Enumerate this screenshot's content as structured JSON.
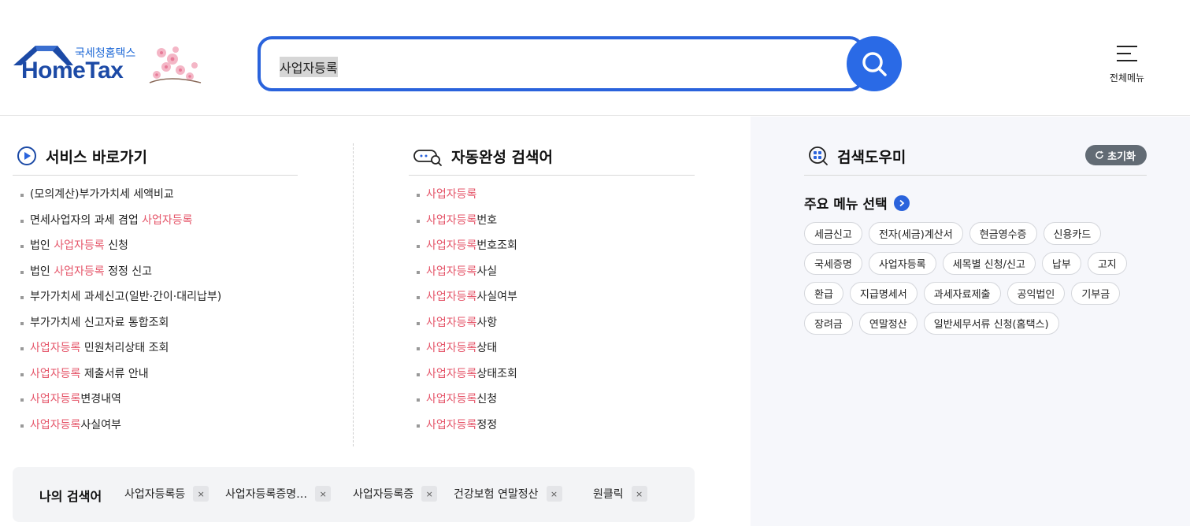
{
  "header": {
    "logo_kr": "국세청홈택스",
    "logo_en": "HomeTax",
    "search_value": "사업자등록",
    "menu_label": "전체메뉴"
  },
  "service": {
    "title": "서비스 바로가기",
    "items": [
      {
        "pre": "(모의계산)부가가치세 세액비교",
        "hl": "",
        "post": ""
      },
      {
        "pre": "면세사업자의 과세 겸업 ",
        "hl": "사업자등록",
        "post": ""
      },
      {
        "pre": "법인 ",
        "hl": "사업자등록",
        "post": " 신청"
      },
      {
        "pre": "법인 ",
        "hl": "사업자등록",
        "post": " 정정 신고"
      },
      {
        "pre": "부가가치세 과세신고(일반·간이·대리납부)",
        "hl": "",
        "post": ""
      },
      {
        "pre": "부가가치세 신고자료 통합조회",
        "hl": "",
        "post": ""
      },
      {
        "pre": "",
        "hl": "사업자등록",
        "post": " 민원처리상태 조회"
      },
      {
        "pre": "",
        "hl": "사업자등록",
        "post": " 제출서류 안내"
      },
      {
        "pre": "",
        "hl": "사업자등록",
        "post": "변경내역"
      },
      {
        "pre": "",
        "hl": "사업자등록",
        "post": "사실여부"
      }
    ]
  },
  "autocomplete": {
    "title": "자동완성 검색어",
    "items": [
      {
        "hl": "사업자등록",
        "post": ""
      },
      {
        "hl": "사업자등록",
        "post": "번호"
      },
      {
        "hl": "사업자등록",
        "post": "번호조회"
      },
      {
        "hl": "사업자등록",
        "post": "사실"
      },
      {
        "hl": "사업자등록",
        "post": "사실여부"
      },
      {
        "hl": "사업자등록",
        "post": "사항"
      },
      {
        "hl": "사업자등록",
        "post": "상태"
      },
      {
        "hl": "사업자등록",
        "post": "상태조회"
      },
      {
        "hl": "사업자등록",
        "post": "신청"
      },
      {
        "hl": "사업자등록",
        "post": "정정"
      }
    ]
  },
  "helper": {
    "title": "검색도우미",
    "reset_label": "초기화",
    "sub_title": "주요 메뉴 선택",
    "chips": [
      "세금신고",
      "전자(세금)계산서",
      "현금영수증",
      "신용카드",
      "국세증명",
      "사업자등록",
      "세목별 신청/신고",
      "납부",
      "고지",
      "환급",
      "지급명세서",
      "과세자료제출",
      "공익법인",
      "기부금",
      "장려금",
      "연말정산",
      "일반세무서류 신청(홈택스)"
    ]
  },
  "recent": {
    "label": "나의 검색어",
    "items": [
      "사업자등록등",
      "사업자등록증명…",
      "사업자등록증",
      "건강보험 연말정산",
      "원클릭"
    ],
    "close_glyph": "×"
  },
  "colors": {
    "accent": "#2a63dc",
    "highlight": "#e5566a",
    "panel_bg": "#f6f7fb"
  }
}
